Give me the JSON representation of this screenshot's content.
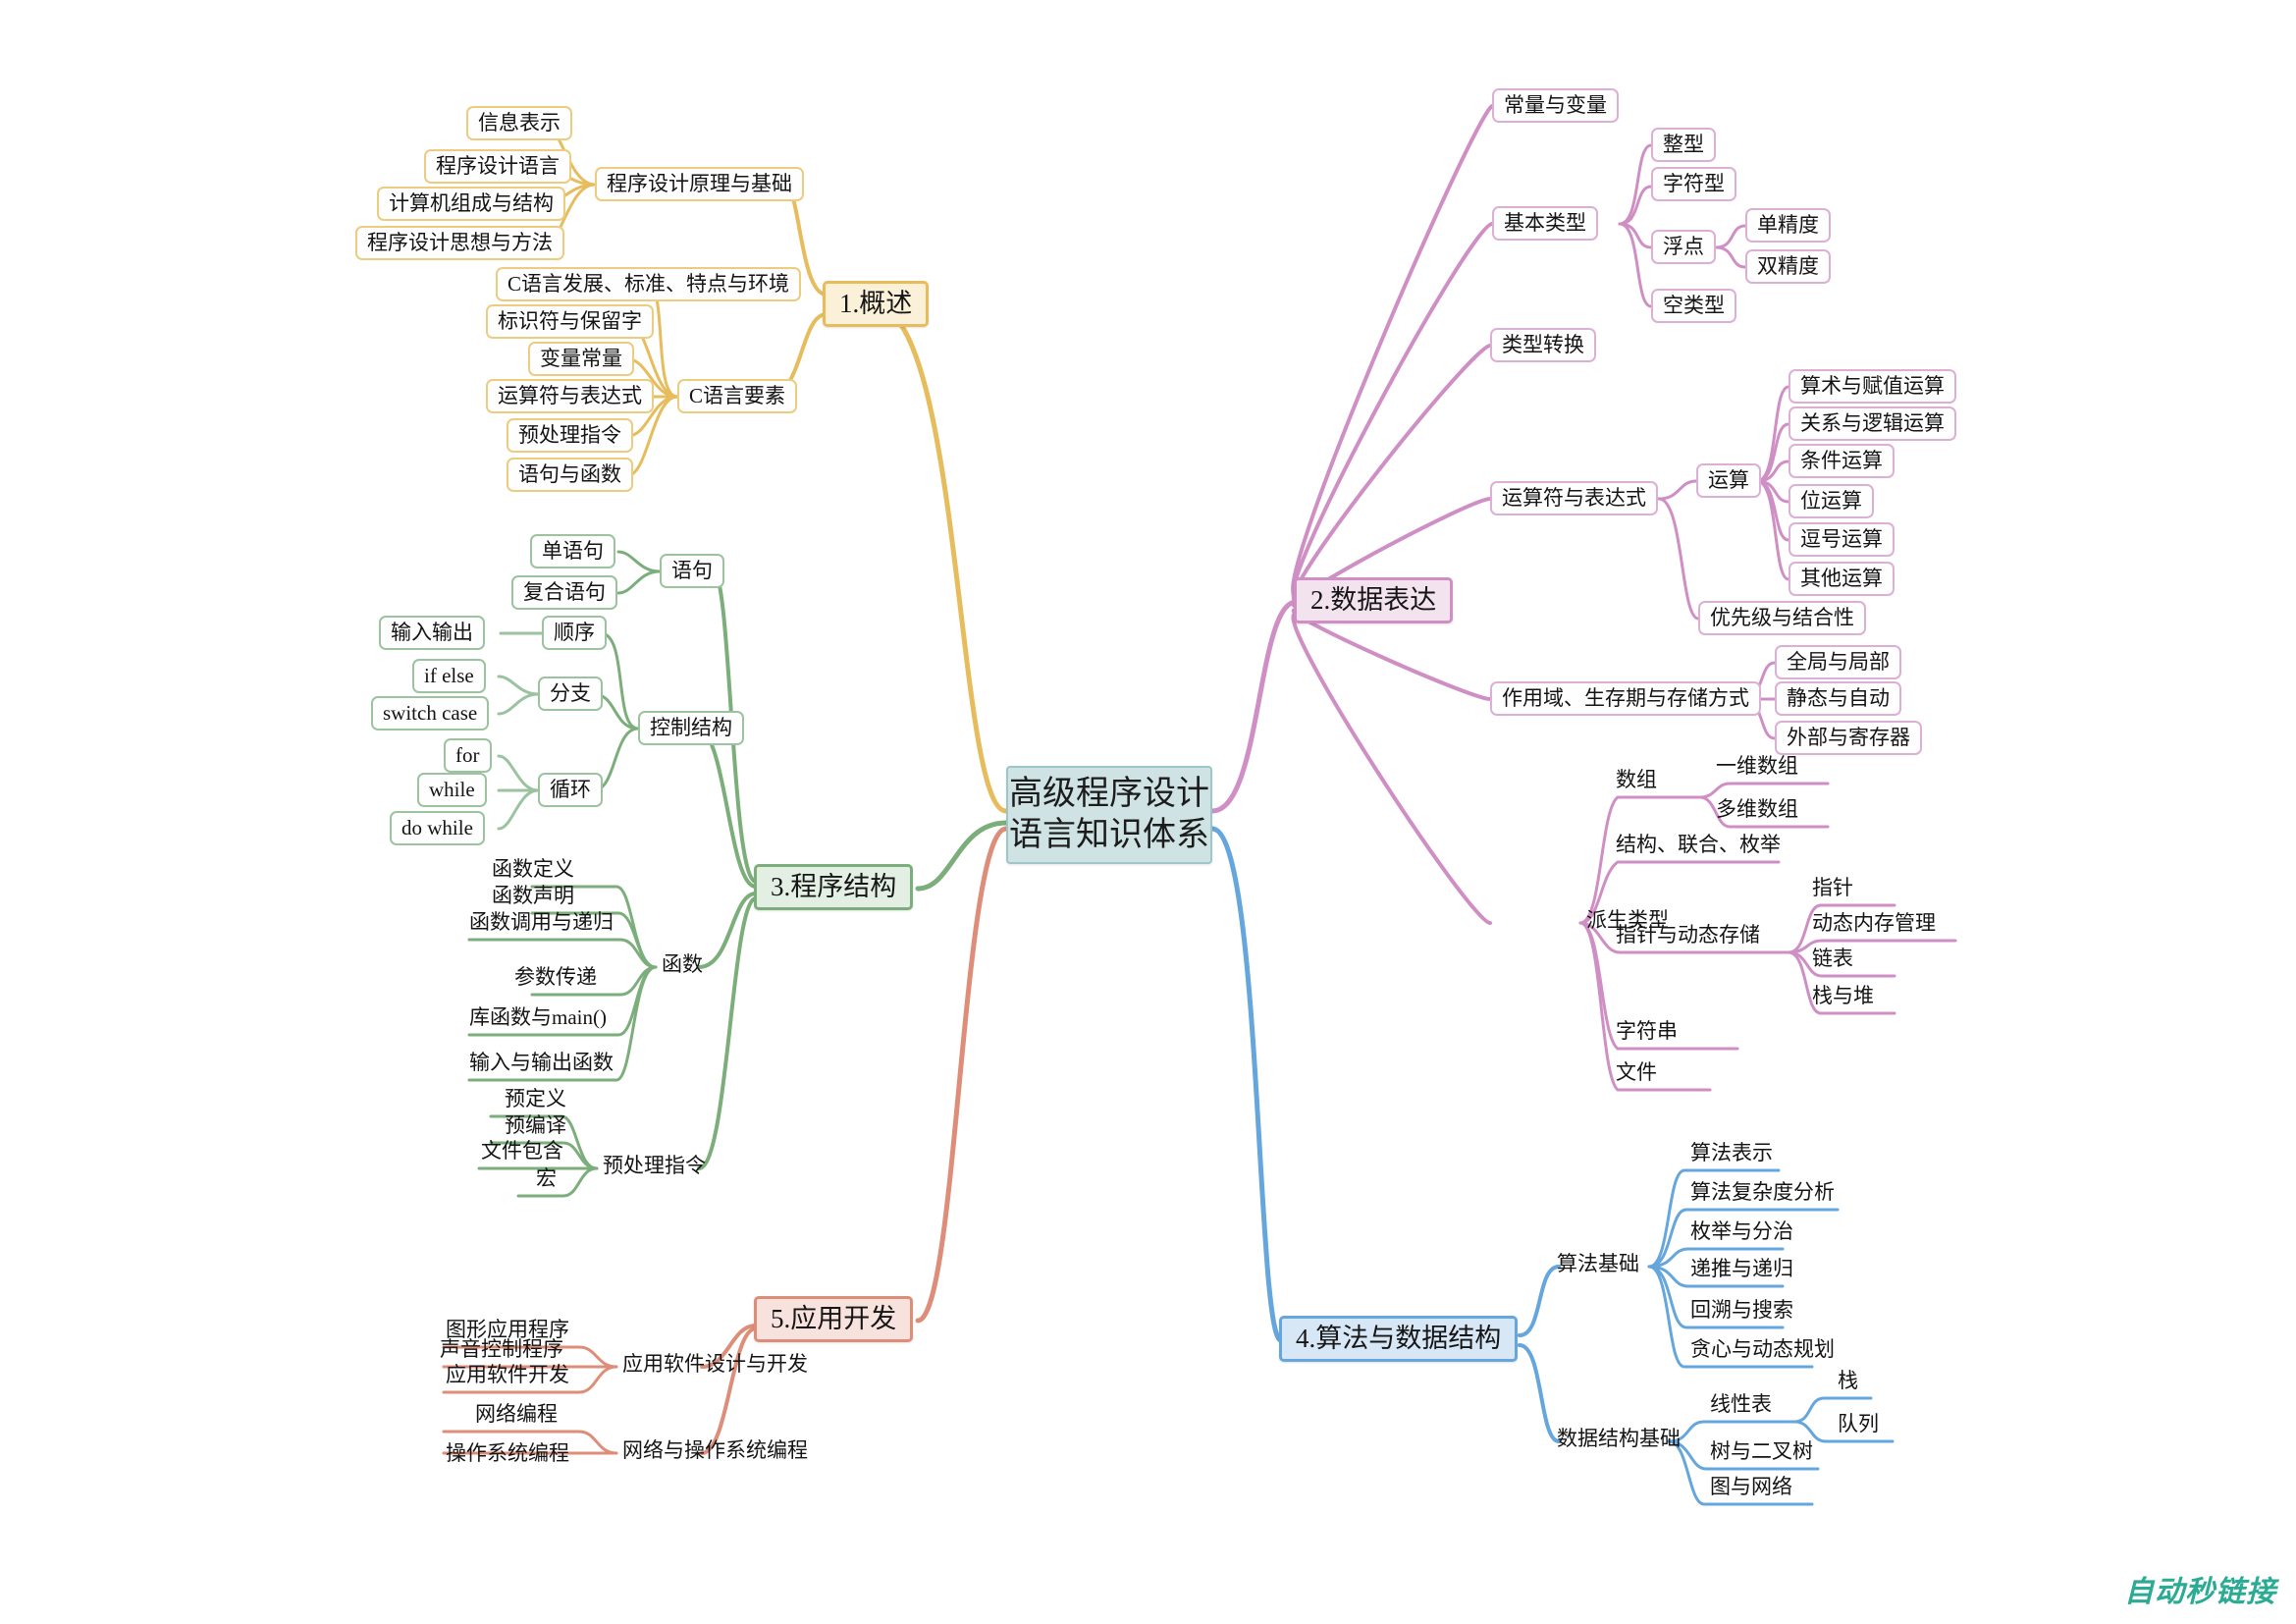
{
  "root": {
    "line1": "高级程序设计",
    "line2": "语言知识体系"
  },
  "watermark": "自动秒链接",
  "colors": {
    "root_fill": "#cfe3e4",
    "root_stroke": "#9ec6c9",
    "b1": "#e7bc5d",
    "b2": "#cf8fc4",
    "b3": "#7cae7c",
    "b4": "#65a6dc",
    "b5": "#dd8d78",
    "watermark": "#2bab93"
  },
  "branches": {
    "b1": {
      "label": "1.概述"
    },
    "b2": {
      "label": "2.数据表达"
    },
    "b3": {
      "label": "3.程序结构"
    },
    "b4": {
      "label": "4.算法与数据结构"
    },
    "b5": {
      "label": "5.应用开发"
    }
  },
  "nodes": {
    "n_xxbs": "信息表示",
    "n_cxsjyy": "程序设计语言",
    "n_jsjzcyjg": "计算机组成与结构",
    "n_cxsjsxyff": "程序设计思想与方法",
    "n_cxsjylyjc": "程序设计原理与基础",
    "n_cyyfz": "C语言发展、标准、特点与环境",
    "n_bsfybly": "标识符与保留字",
    "n_blcl": "变量常量",
    "n_ysfybds1": "运算符与表达式",
    "n_yclzl1": "预处理指令",
    "n_yjyhs": "语句与函数",
    "n_cyyys": "C语言要素",
    "n_clbl": "常量与变量",
    "n_zx": "整型",
    "n_zfx": "字符型",
    "n_djd": "单精度",
    "n_sjd": "双精度",
    "n_fd": "浮点",
    "n_klx": "空类型",
    "n_jblx": "基本类型",
    "n_lxzh": "类型转换",
    "n_ssyfzys": "算术与赋值运算",
    "n_gxylkys": "关系与逻辑运算",
    "n_tjys": "条件运算",
    "n_wys": "位运算",
    "n_dhys": "逗号运算",
    "n_qtys": "其他运算",
    "n_ys": "运算",
    "n_yxjyjhx": "优先级与结合性",
    "n_ysfybds2": "运算符与表达式",
    "n_qjyjb": "全局与局部",
    "n_jtyzd": "静态与自动",
    "n_wbyjcq": "外部与寄存器",
    "n_zyyscq": "作用域、生存期与存储方式",
    "n_ywsz": "一维数组",
    "n_dwsz": "多维数组",
    "n_sz": "数组",
    "n_jglhmj": "结构、联合、枚举",
    "n_zz": "指针",
    "n_dtnccl": "动态内存管理",
    "n_lb": "链表",
    "n_zyd": "栈与堆",
    "n_zzydtcc": "指针与动态存储",
    "n_zfc": "字符串",
    "n_wj": "文件",
    "n_pslx": "派生类型",
    "n_dyj": "单语句",
    "n_fhyj": "复合语句",
    "n_yj": "语句",
    "n_srsc": "输入输出",
    "n_sx": "顺序",
    "n_ifelse": "if else",
    "n_switchcase": "switch case",
    "n_fz": "分支",
    "n_for": "for",
    "n_while": "while",
    "n_dowhile": "do while",
    "n_xh": "循环",
    "n_kzjg": "控制结构",
    "n_hsdy": "函数定义",
    "n_hssm": "函数声明",
    "n_hsdydg": "函数调用与递归",
    "n_csmd": "参数传递",
    "n_khsmain": "库函数与main()",
    "n_sryschs": "输入与输出函数",
    "n_hs": "函数",
    "n_ydy": "预定义",
    "n_ybj": "预编译",
    "n_wjbh": "文件包含",
    "n_h": "宏",
    "n_yclzl2": "预处理指令",
    "n_sfbs": "算法表示",
    "n_sfzfdfx": "算法复杂度分析",
    "n_mjyfz": "枚举与分治",
    "n_dtydg": "递推与递归",
    "n_hsyss": "回溯与搜索",
    "n_txydtgh": "贪心与动态规划",
    "n_sfjc": "算法基础",
    "n_zhan": "栈",
    "n_dl": "队列",
    "n_xxb": "线性表",
    "n_syecs": "树与二叉树",
    "n_tywl": "图与网络",
    "n_sjjgjc": "数据结构基础",
    "n_txyycx": "图形应用程序",
    "n_syktcx": "声音控制程序",
    "n_yyrjkf": "应用软件开发",
    "n_yyrjsjykf": "应用软件设计与开发",
    "n_wlbc": "网络编程",
    "n_zzxtbc": "操作系统编程",
    "n_wlyzzxtbc": "网络与操作系统编程"
  }
}
